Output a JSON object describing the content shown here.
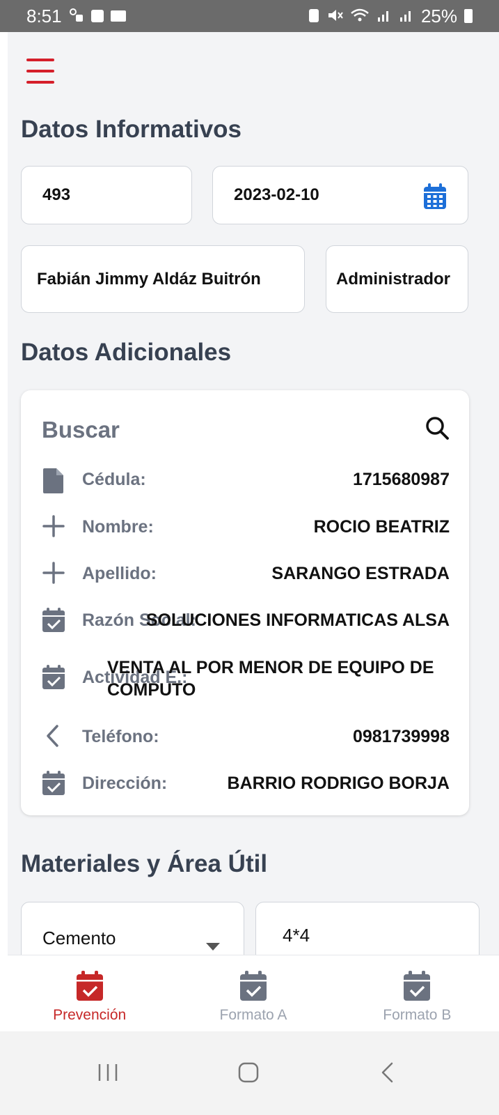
{
  "status_bar": {
    "time": "8:51",
    "battery": "25%",
    "icons": [
      "sim-icon",
      "check-icon",
      "folder-icon",
      "lock-battery-icon",
      "mute-icon",
      "wifi-icon",
      "signal-icon",
      "signal-icon",
      "battery-icon"
    ]
  },
  "colors": {
    "accent": "#d51f2a",
    "nav_active": "#c62828",
    "nav_inactive": "#6b7280",
    "calendar_blue": "#1d6fd8"
  },
  "sections": {
    "informativos": "Datos Informativos",
    "adicionales": "Datos Adicionales",
    "materiales": "Materiales y Área Útil"
  },
  "informativos": {
    "number": "493",
    "date": "2023-02-10",
    "name": "Fabián Jimmy Aldáz Buitrón",
    "role": "Administrador"
  },
  "adicionales": {
    "search_label": "Buscar",
    "rows": [
      {
        "icon": "document-icon",
        "label": "Cédula:",
        "value": "1715680987"
      },
      {
        "icon": "plus-icon",
        "label": "Nombre:",
        "value": "ROCIO BEATRIZ"
      },
      {
        "icon": "plus-icon",
        "label": "Apellido:",
        "value": "SARANGO ESTRADA"
      },
      {
        "icon": "calendar-check-icon",
        "label": "Razón Social:",
        "value": "SOLUCIONES INFORMATICAS ALSA"
      },
      {
        "icon": "calendar-check-icon",
        "label": "Actividad E.:",
        "value": "VENTA AL POR MENOR DE EQUIPO DE COMPUTO"
      },
      {
        "icon": "chevron-left-icon",
        "label": "Teléfono:",
        "value": "0981739998"
      },
      {
        "icon": "calendar-check-icon",
        "label": "Dirección:",
        "value": "BARRIO RODRIGO BORJA"
      }
    ]
  },
  "materiales": {
    "material_selected": "Cemento",
    "area": "4*4"
  },
  "bottom_nav": {
    "items": [
      {
        "label": "Prevención",
        "active": true
      },
      {
        "label": "Formato A",
        "active": false
      },
      {
        "label": "Formato B",
        "active": false
      }
    ]
  }
}
